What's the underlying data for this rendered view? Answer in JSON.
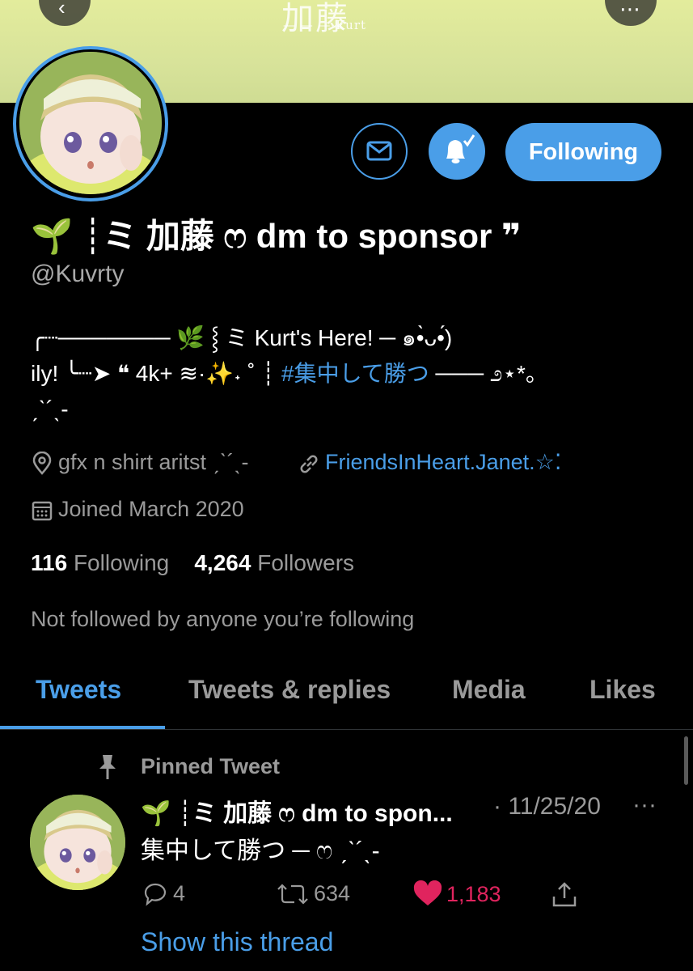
{
  "banner": {
    "logo_text": "加藤",
    "sub_text": "— — — Kurt"
  },
  "nav": {
    "back_glyph": "‹",
    "more_glyph": "⋯"
  },
  "actions": {
    "follow_label": "Following"
  },
  "profile": {
    "name": "🌱 ┊ミ 加藤 ෆ dm to sponsor ❞",
    "handle": "@Kuvrty",
    "bio_line1": "╭┈─────── 🌿 ⸾ ミ Kurt's Here! ─ ๑•̀ᴗ•́)",
    "bio_line2_a": "ily! ╰┈➤ ❝ 4k+ ≋·✨˖ ˚ ┊",
    "bio_line2_hashtag": "#集中して勝つ",
    "bio_line2_b": " ─── ೨⋆*。",
    "bio_line3": "ˏˋ´ˎ-",
    "location": "gfx n shirt aritst ˏˋ´ˎ-",
    "website": "FriendsInHeart.Janet.☆⁚",
    "joined": "Joined March 2020",
    "following_count": "116",
    "following_label": "Following",
    "followers_count": "4,264",
    "followers_label": "Followers",
    "not_followed": "Not followed by anyone you’re following"
  },
  "tabs": [
    {
      "label": "Tweets"
    },
    {
      "label": "Tweets & replies"
    },
    {
      "label": "Media"
    },
    {
      "label": "Likes"
    }
  ],
  "pinned_tweet": {
    "pinned_label": "Pinned Tweet",
    "author": "🌱 ┊ミ 加藤 ෆ dm to spon...",
    "date": "· 11/25/20",
    "more": "···",
    "text": "集中して勝つ ─ ෆ ˏˋ´ˎ-",
    "replies": "4",
    "retweets": "634",
    "likes": "1,183",
    "show_thread": "Show this thread"
  },
  "colors": {
    "accent": "#4a9ee8",
    "like": "#e0245e",
    "muted": "#9a9a9a",
    "banner": "#dbe49a"
  },
  "icons": [
    "back-icon",
    "more-icon",
    "mail-icon",
    "bell-icon",
    "location-icon",
    "link-icon",
    "calendar-icon",
    "pin-icon",
    "reply-icon",
    "retweet-icon",
    "like-icon",
    "share-icon"
  ]
}
